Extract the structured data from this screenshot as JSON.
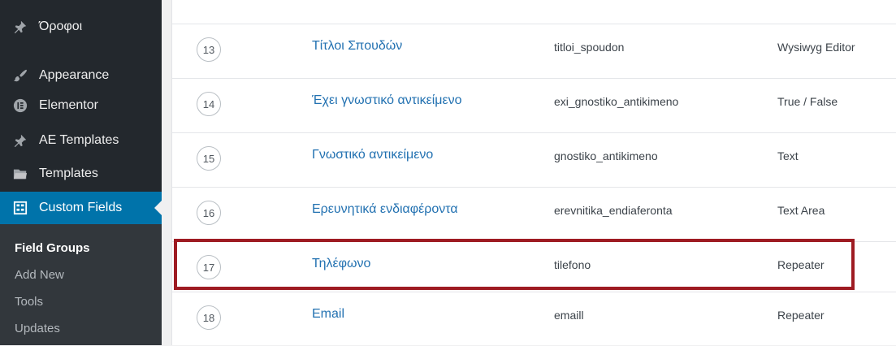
{
  "sidebar": {
    "items": [
      {
        "label": "Όροφοι",
        "icon": "pin-icon"
      },
      {
        "label": "Appearance",
        "icon": "paintbrush-icon"
      },
      {
        "label": "Elementor",
        "icon": "elementor-icon"
      },
      {
        "label": "AE Templates",
        "icon": "pin-icon"
      },
      {
        "label": "Templates",
        "icon": "folder-icon"
      },
      {
        "label": "Custom Fields",
        "icon": "grid-icon",
        "current": true
      }
    ],
    "submenu": [
      {
        "label": "Field Groups",
        "active": true
      },
      {
        "label": "Add New"
      },
      {
        "label": "Tools"
      },
      {
        "label": "Updates"
      }
    ]
  },
  "fields": [
    {
      "order": "13",
      "label": "Τίτλοι Σπουδών",
      "name": "titloi_spoudon",
      "type": "Wysiwyg Editor"
    },
    {
      "order": "14",
      "label": "Έχει γνωστικό αντικείμενο",
      "name": "exi_gnostiko_antikimeno",
      "type": "True / False"
    },
    {
      "order": "15",
      "label": "Γνωστικό αντικείμενο",
      "name": "gnostiko_antikimeno",
      "type": "Text"
    },
    {
      "order": "16",
      "label": "Ερευνητικά ενδιαφέροντα",
      "name": "erevnitika_endiaferonta",
      "type": "Text Area"
    },
    {
      "order": "17",
      "label": "Τηλέφωνο",
      "name": "tilefono",
      "type": "Repeater",
      "highlighted": true
    },
    {
      "order": "18",
      "label": "Email",
      "name": "emaill",
      "type": "Repeater"
    }
  ],
  "colors": {
    "sidebar_bg": "#23282d",
    "current_menu_bg": "#0073aa",
    "link": "#2271b1",
    "highlight": "#9e1b22"
  }
}
